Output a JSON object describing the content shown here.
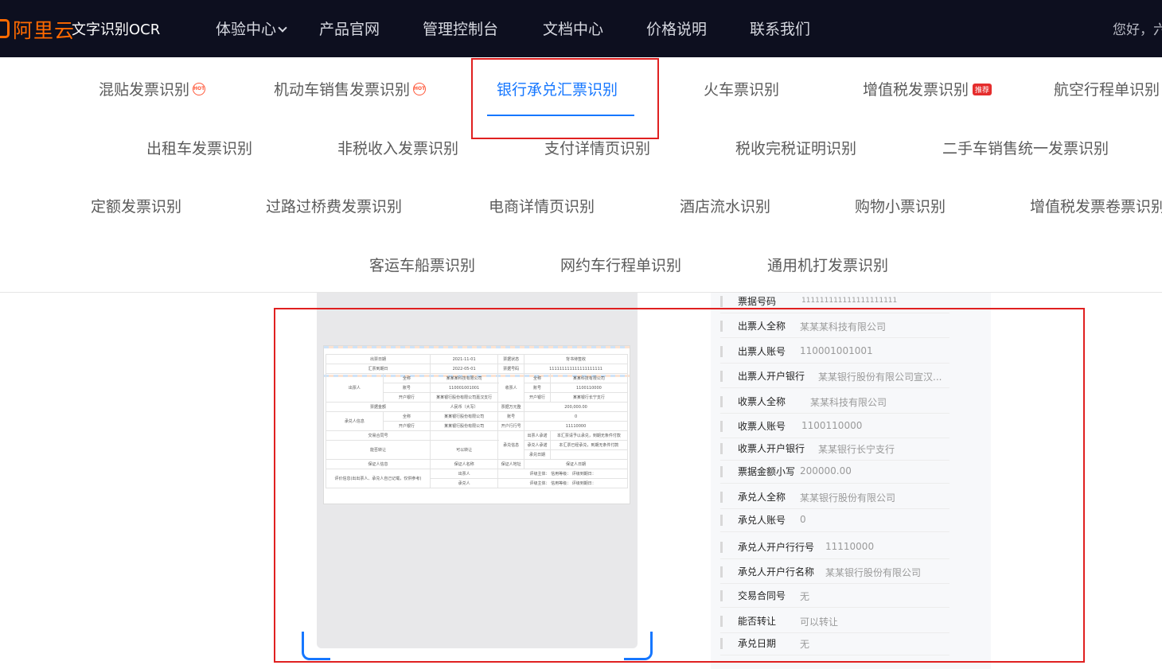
{
  "header": {
    "brand": "阿里云",
    "product": "文字识别OCR",
    "nav": [
      {
        "label": "体验中心"
      },
      {
        "label": "产品官网"
      },
      {
        "label": "管理控制台"
      },
      {
        "label": "文档中心"
      },
      {
        "label": "价格说明"
      },
      {
        "label": "联系我们"
      }
    ],
    "greeting": "您好，六"
  },
  "tabs": {
    "row1": [
      {
        "label": "混贴发票识别",
        "badge": "HOT"
      },
      {
        "label": "机动车销售发票识别",
        "badge": "HOT"
      },
      {
        "label": "银行承兑汇票识别",
        "active": true
      },
      {
        "label": "火车票识别"
      },
      {
        "label": "增值税发票识别",
        "badge": "推荐"
      },
      {
        "label": "航空行程单识别"
      }
    ],
    "row2": [
      {
        "label": "出租车发票识别"
      },
      {
        "label": "非税收入发票识别"
      },
      {
        "label": "支付详情页识别"
      },
      {
        "label": "税收完税证明识别"
      },
      {
        "label": "二手车销售统一发票识别"
      }
    ],
    "row3": [
      {
        "label": "定额发票识别"
      },
      {
        "label": "过路过桥费发票识别"
      },
      {
        "label": "电商详情页识别"
      },
      {
        "label": "酒店流水识别"
      },
      {
        "label": "购物小票识别"
      },
      {
        "label": "增值税发票卷票识别"
      }
    ],
    "row4": [
      {
        "label": "客运车船票识别"
      },
      {
        "label": "网约车行程单识别"
      },
      {
        "label": "通用机打发票识别"
      }
    ]
  },
  "document": {
    "r1": [
      "出票日期",
      "2021-11-01",
      "票据状态",
      "背书待签收"
    ],
    "r2": [
      "汇票到期日",
      "2022-05-01",
      "票据号码",
      "111111111111111111111"
    ],
    "drawer": "出票人",
    "payee": "收票人",
    "name_l": "全称",
    "account_l": "账号",
    "bank_l": "开户银行",
    "drawer_name": "某某某科技有限公司",
    "drawer_account": "110001001001",
    "drawer_bank": "某某银行股份有限公司嘉汉支行",
    "payee_name": "某某科技有限公司",
    "payee_account": "1100110000",
    "payee_bank": "某某银行长宁支行",
    "amount_l": "票据金额",
    "amount_v": "人民币（大写）",
    "amount_small_l": "票据万元整",
    "amount_small_v": "200,000.00",
    "acceptor": "承兑人信息",
    "acc_name": "某某银行股份有限公司",
    "acc_account_v": "0",
    "acc_bank": "某某银行股份有限公司",
    "acc_bank_no_l": "开户行行号",
    "acc_bank_no_v": "11110000",
    "contract": "交易合同号",
    "commit_l": "承兑信息",
    "commit_1": "出票人承诺",
    "commit_1_v": "本汇票请予以承兑，到期无条件付款",
    "commit_2": "承兑人承诺",
    "commit_2_v": "本汇票已经承兑，到期无条件付款",
    "accept_date": "承兑日期",
    "transfer_l": "能否转让",
    "transfer_v": "可以转让",
    "guarantee": "保证人信息",
    "guarantee_name": "保证人名称",
    "guarantee_addr": "保证人地址",
    "guarantee_date": "保证人日期",
    "rating_l": "评价信息(出出票人、承兑人自己记载，仅供参考)",
    "rating_1": "出票人",
    "rating_1_v": "评级主体：   信用等级：   评级到期日：",
    "rating_2": "承兑人",
    "rating_2_v": "评级主体：   信用等级：   评级到期日："
  },
  "results": [
    {
      "key": "票据号码",
      "value": "111111111111111111111"
    },
    {
      "key": "出票人全称",
      "value": "某某某科技有限公司"
    },
    {
      "key": "出票人账号",
      "value": "110001001001"
    },
    {
      "key": "出票人开户银行",
      "value": "某某银行股份有限公司宣汉..."
    },
    {
      "key": "收票人全称",
      "value": "某某科技有限公司"
    },
    {
      "key": "收票人账号",
      "value": "1100110000"
    },
    {
      "key": "收票人开户银行",
      "value": "某某银行长宁支行"
    },
    {
      "key": "票据金额小写",
      "value": "200000.00"
    },
    {
      "key": "承兑人全称",
      "value": "某某银行股份有限公司"
    },
    {
      "key": "承兑人账号",
      "value": "0"
    },
    {
      "key": "承兑人开户行行号",
      "value": "11110000"
    },
    {
      "key": "承兑人开户行名称",
      "value": "某某银行股份有限公司"
    },
    {
      "key": "交易合同号",
      "value": "无"
    },
    {
      "key": "能否转让",
      "value": "可以转让"
    },
    {
      "key": "承兑日期",
      "value": "无"
    }
  ],
  "colors": {
    "nav_bg": "#0d0f1f",
    "brand": "#ff6a00",
    "active_tab": "#1677ff",
    "highlight": "#e02020"
  }
}
